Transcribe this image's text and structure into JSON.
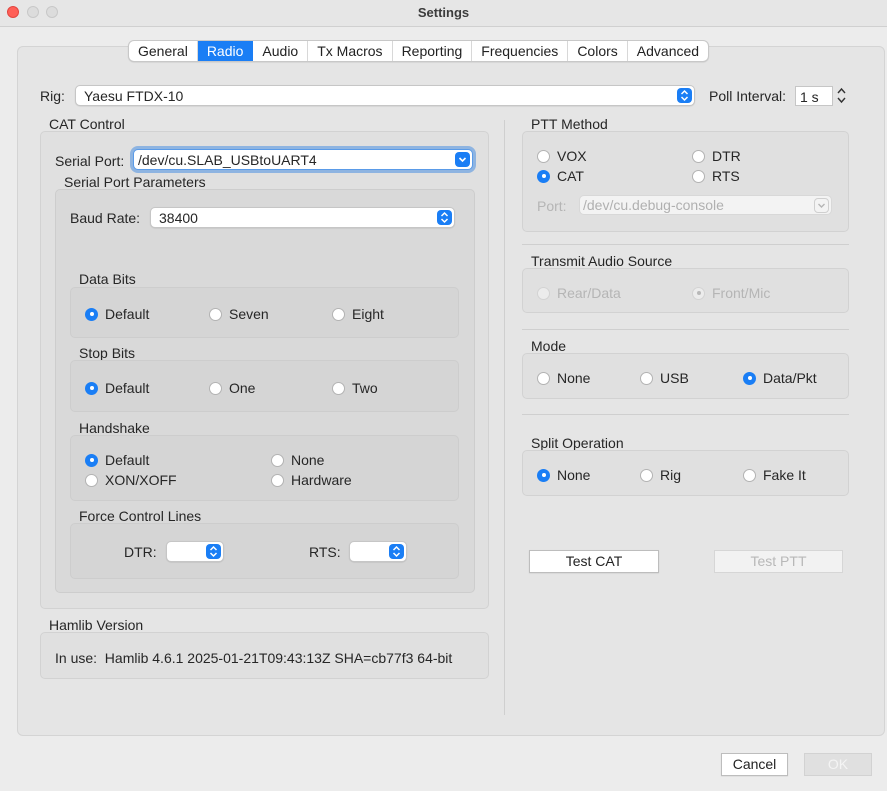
{
  "window": {
    "title": "Settings"
  },
  "tabs": [
    "General",
    "Radio",
    "Audio",
    "Tx Macros",
    "Reporting",
    "Frequencies",
    "Colors",
    "Advanced"
  ],
  "active_tab": "Radio",
  "rig": {
    "label": "Rig:",
    "value": "Yaesu FTDX-10"
  },
  "poll": {
    "label": "Poll Interval:",
    "value": "1 s"
  },
  "cat": {
    "title": "CAT Control",
    "serial_port_label": "Serial Port:",
    "serial_port_value": "/dev/cu.SLAB_USBtoUART4",
    "params_title": "Serial Port Parameters",
    "baud_label": "Baud Rate:",
    "baud_value": "38400",
    "data_bits": {
      "title": "Data Bits",
      "options": [
        "Default",
        "Seven",
        "Eight"
      ],
      "selected": "Default"
    },
    "stop_bits": {
      "title": "Stop Bits",
      "options": [
        "Default",
        "One",
        "Two"
      ],
      "selected": "Default"
    },
    "handshake": {
      "title": "Handshake",
      "options": [
        "Default",
        "None",
        "XON/XOFF",
        "Hardware"
      ],
      "selected": "Default"
    },
    "force": {
      "title": "Force Control Lines",
      "dtr_label": "DTR:",
      "rts_label": "RTS:"
    }
  },
  "hamlib": {
    "title": "Hamlib Version",
    "text": "In use:  Hamlib 4.6.1 2025-01-21T09:43:13Z SHA=cb77f3 64-bit"
  },
  "ptt": {
    "title": "PTT Method",
    "options": [
      "VOX",
      "DTR",
      "CAT",
      "RTS"
    ],
    "selected": "CAT",
    "port_label": "Port:",
    "port_value": "/dev/cu.debug-console"
  },
  "tx_audio": {
    "title": "Transmit Audio Source",
    "options": [
      "Rear/Data",
      "Front/Mic"
    ],
    "selected": "Front/Mic"
  },
  "mode": {
    "title": "Mode",
    "options": [
      "None",
      "USB",
      "Data/Pkt"
    ],
    "selected": "Data/Pkt"
  },
  "split": {
    "title": "Split Operation",
    "options": [
      "None",
      "Rig",
      "Fake It"
    ],
    "selected": "None"
  },
  "buttons": {
    "test_cat": "Test CAT",
    "test_ptt": "Test PTT",
    "cancel": "Cancel",
    "ok": "OK"
  },
  "colors": {
    "accent": "#1a7ef5",
    "close": "#ff5f57",
    "inactive": "#dcdcdc"
  }
}
